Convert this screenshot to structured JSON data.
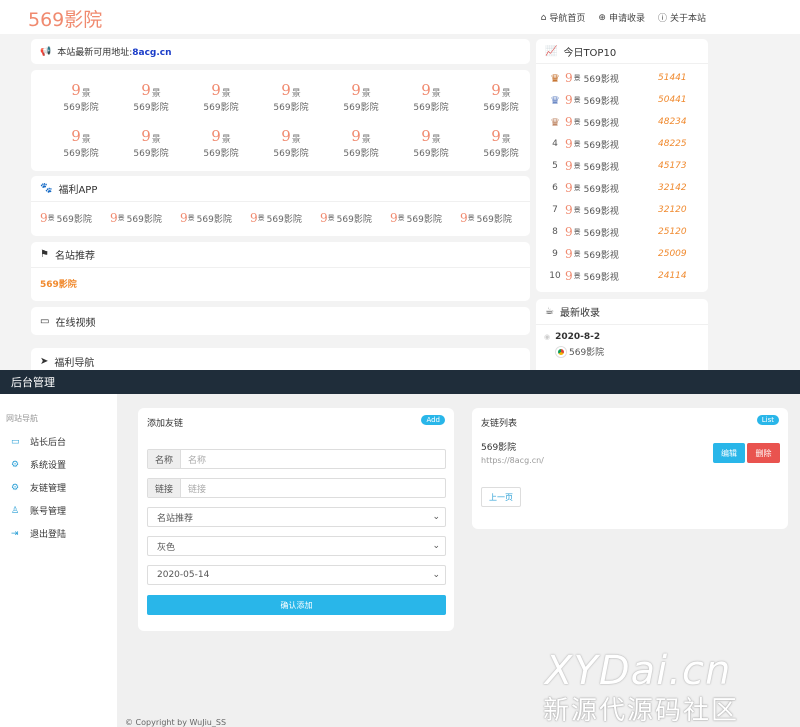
{
  "site": {
    "logo": "569影院",
    "nav": [
      {
        "icon": "home-icon",
        "glyph": "⌂",
        "label": "导航首页"
      },
      {
        "icon": "plus-icon",
        "glyph": "⊕",
        "label": "申请收录"
      },
      {
        "icon": "info-icon",
        "glyph": "ⓘ",
        "label": "关于本站"
      }
    ],
    "notice": {
      "prefix": "本站最新可用地址:",
      "link": "8acg.cn"
    },
    "grid_item": {
      "num": "9",
      "sub": "景",
      "label": "569影院"
    },
    "grid_rows": 2,
    "grid_cols": 7,
    "welfare_title": "福利APP",
    "app_label": "569影院",
    "recommend_title": "名站推荐",
    "recommend_item": "569影院",
    "video_title": "在线视频",
    "welfare_nav_title": "福利导航",
    "top10": {
      "title": "今日TOP10",
      "name": "569影视",
      "rows": [
        {
          "rank": "1",
          "value": "51441"
        },
        {
          "rank": "2",
          "value": "50441"
        },
        {
          "rank": "3",
          "value": "48234"
        },
        {
          "rank": "4",
          "value": "48225"
        },
        {
          "rank": "5",
          "value": "45173"
        },
        {
          "rank": "6",
          "value": "32142"
        },
        {
          "rank": "7",
          "value": "32120"
        },
        {
          "rank": "8",
          "value": "25120"
        },
        {
          "rank": "9",
          "value": "25009"
        },
        {
          "rank": "10",
          "value": "24114"
        }
      ]
    },
    "latest": {
      "title": "最新收录",
      "date": "2020-8-2",
      "item": "569影院"
    }
  },
  "admin": {
    "title": "后台管理",
    "sidebar_title": "网站导航",
    "menu": [
      {
        "icon": "monitor-icon",
        "glyph": "▭",
        "label": "站长后台"
      },
      {
        "icon": "gear-icon",
        "glyph": "⚙",
        "label": "系统设置"
      },
      {
        "icon": "gear-icon",
        "glyph": "⚙",
        "label": "友链管理"
      },
      {
        "icon": "user-icon",
        "glyph": "♙",
        "label": "账号管理"
      },
      {
        "icon": "logout-icon",
        "glyph": "⇥",
        "label": "退出登陆"
      }
    ],
    "add": {
      "title": "添加友链",
      "badge": "Add",
      "name_label": "名称",
      "name_placeholder": "名称",
      "link_label": "链接",
      "link_placeholder": "链接",
      "category": "名站推荐",
      "color": "灰色",
      "date": "2020-05-14",
      "submit": "确认添加"
    },
    "list": {
      "title": "友链列表",
      "badge": "List",
      "item_name": "569影院",
      "item_url": "https://8acg.cn/",
      "edit": "编辑",
      "delete": "删除",
      "prev": "上一页"
    },
    "copyright": "© Copyright by WuJiu_SS"
  },
  "watermark": {
    "line1": "XYDai.cn",
    "line2": "新源代源码社区"
  },
  "colors": {
    "accent": "#29b6e9",
    "logo": "#f08a6f",
    "delete": "#e9534f",
    "rank": "#f08a2f"
  }
}
